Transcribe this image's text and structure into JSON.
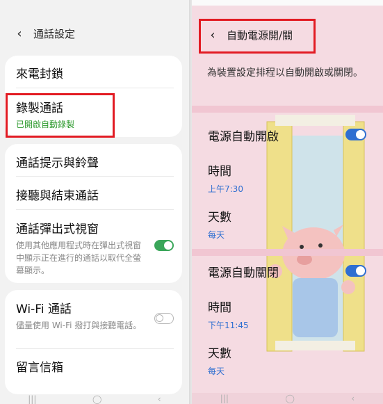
{
  "left": {
    "header": {
      "back_icon": "chevron-left",
      "title": "通話設定"
    },
    "items": {
      "call_block": {
        "label": "來電封鎖"
      },
      "record_calls": {
        "label": "錄製通話",
        "status": "已開啟自動錄製"
      },
      "ringtones": {
        "label": "通話提示與鈴聲"
      },
      "answer_end": {
        "label": "接聽與結束通話"
      },
      "popup": {
        "label": "通話彈出式視窗",
        "description": "使用其他應用程式時在彈出式視窗中顯示正在進行的通話以取代全螢幕顯示。",
        "toggle_on": true
      },
      "wifi_calling": {
        "label": "Wi-Fi 通話",
        "description": "儘量使用 Wi-Fi 撥打與接聽電話。",
        "toggle_on": false
      },
      "voicemail": {
        "label": "留言信箱"
      }
    }
  },
  "right": {
    "header": {
      "back_icon": "chevron-left",
      "title": "自動電源開/關"
    },
    "description": "為裝置設定排程以自動開啟或關閉。",
    "power_on": {
      "label": "電源自動開啟",
      "toggle_on": true,
      "time_label": "時間",
      "time_value": "上午7:30",
      "days_label": "天數",
      "days_value": "每天"
    },
    "power_off": {
      "label": "電源自動關閉",
      "toggle_on": true,
      "time_label": "時間",
      "time_value": "下午11:45",
      "days_label": "天數",
      "days_value": "每天"
    }
  },
  "colors": {
    "highlight_box": "#e21b23",
    "toggle_on_left": "#3aa65a",
    "toggle_on_right": "#2f6fd1",
    "status_green": "#2e9a2e"
  }
}
